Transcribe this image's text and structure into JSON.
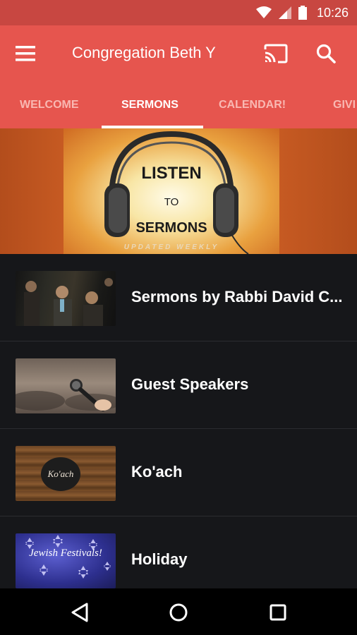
{
  "status_bar": {
    "time": "10:26",
    "icons": [
      "wifi-icon",
      "signal-icon",
      "battery-icon"
    ]
  },
  "app_bar": {
    "title": "Congregation Beth Y",
    "icons": [
      "menu-icon",
      "cast-icon",
      "search-icon"
    ],
    "color": "#e6554e"
  },
  "tabs": [
    {
      "label": "WELCOME",
      "active": false
    },
    {
      "label": "SERMONS",
      "active": true
    },
    {
      "label": "CALENDAR!",
      "active": false
    },
    {
      "label": "GIVI",
      "active": false
    }
  ],
  "banner": {
    "line1": "LISTEN",
    "line2": "TO",
    "line3": "SERMONS",
    "subtitle": "UPDATED WEEKLY"
  },
  "list": {
    "items": [
      {
        "label": "Sermons by Rabbi David C...",
        "thumb": "speakers-photo"
      },
      {
        "label": "Guest Speakers",
        "thumb": "microphone-photo"
      },
      {
        "label": "Ko'ach",
        "thumb": "wood-logo",
        "thumb_text": "Ko'ach"
      },
      {
        "label": "Holiday",
        "thumb": "stars-photo",
        "thumb_text": "Jewish Festivals!"
      }
    ]
  },
  "nav_bar": {
    "icons": [
      "back-icon",
      "home-icon",
      "recents-icon"
    ]
  }
}
